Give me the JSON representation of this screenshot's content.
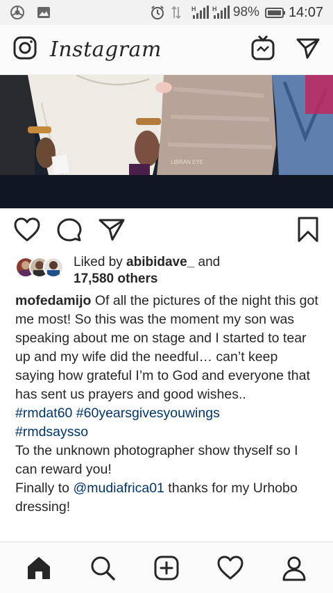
{
  "status_bar": {
    "battery_percent": "98%",
    "time": "14:07",
    "icons": [
      "chrome-icon",
      "gallery-icon",
      "alarm-icon",
      "data-arrows-icon",
      "signal-h-icon",
      "signal-h-icon",
      "battery-icon"
    ]
  },
  "header": {
    "brand": "Instagram",
    "icons": [
      "camera-icon",
      "igtv-icon",
      "direct-message-icon"
    ]
  },
  "post": {
    "photo_watermark": "LIBRAN EYE",
    "actions": [
      "like-icon",
      "comment-icon",
      "share-icon",
      "bookmark-icon"
    ],
    "likes": {
      "prefix": "Liked by ",
      "user": "abibidave_",
      "and": " and",
      "others": "17,580 others"
    },
    "caption": {
      "username": "mofedamijo",
      "text": " Of all the pictures of the night this got me most! So this was the moment my son was speaking about me on stage and I started to tear up and my wife did the needful… can’t keep saying how grateful I’m to God and everyone that has sent us prayers and good wishes..",
      "hashtags_line1": "#rmdat60 #60yearsgivesyouwings",
      "hashtags_line2": "#rmdsaysso",
      "line3": "To the unknown photographer show thyself so I can reward you!",
      "line4_prefix": "Finally to ",
      "mention": "@mudiafrica01",
      "line4_suffix": " thanks for my Urhobo dressing!"
    }
  },
  "bottom_nav": {
    "items": [
      "home-icon",
      "search-icon",
      "new-post-icon",
      "activity-icon",
      "profile-icon"
    ]
  },
  "colors": {
    "link": "#003569",
    "text": "#262626",
    "bar_bg": "#fafafa"
  }
}
